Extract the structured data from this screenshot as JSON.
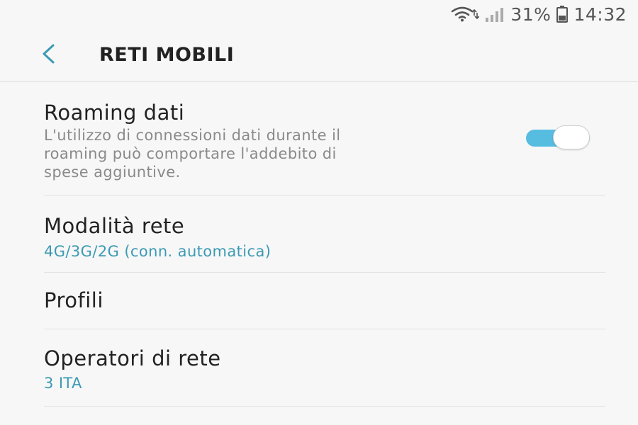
{
  "colors": {
    "accent": "#3c9ab4",
    "toggle_on": "#56bde0"
  },
  "status_bar": {
    "icons": [
      "wifi-data-icon",
      "signal-icon",
      "battery-icon"
    ],
    "battery": "31%",
    "time": "14:32"
  },
  "header": {
    "back_icon": "chevron-left-icon",
    "title": "RETI MOBILI"
  },
  "settings": {
    "roaming": {
      "title": "Roaming dati",
      "summary_lines": [
        "L'utilizzo di connessioni dati durante il",
        "roaming può comportare l'addebito di",
        "spese aggiuntive."
      ],
      "enabled": true
    },
    "network_mode": {
      "title": "Modalità rete",
      "value": "4G/3G/2G (conn. automatica)"
    },
    "profiles": {
      "title": "Profili"
    },
    "operators": {
      "title": "Operatori di rete",
      "value": "3 ITA"
    }
  }
}
